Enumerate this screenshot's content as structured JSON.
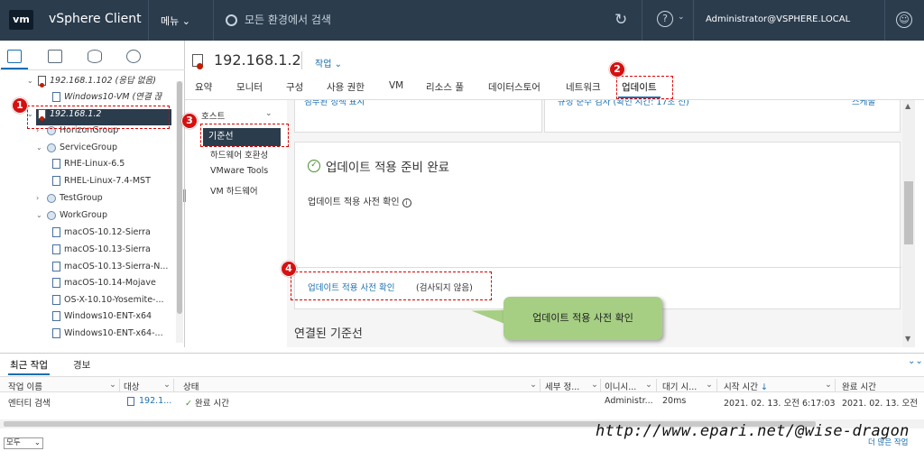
{
  "header": {
    "logo": "vm",
    "app_title": "vSphere Client",
    "menu_label": "메뉴",
    "search_placeholder": "모든 환경에서 검색",
    "user": "Administrator@VSPHERE.LOCAL",
    "colors": {
      "header_bg": "#2b3c4d",
      "accent": "#1a6fb0",
      "selected_bg": "#2b3c4d",
      "annotation": "#d51010",
      "tooltip_bg": "#a6cf84"
    }
  },
  "left_tabs": [
    "hosts-and-clusters-icon",
    "vms-and-templates-icon",
    "storage-icon",
    "networking-icon"
  ],
  "tree": [
    {
      "label": "192.168.1.102 (응답 없음)",
      "type": "host-warning",
      "expanded": true
    },
    {
      "label": "Windows10-VM (연결 끊",
      "type": "vm"
    },
    {
      "label": "192.168.1.2",
      "type": "host-warning",
      "expanded": true,
      "selected": true
    },
    {
      "label": "HorizonGroup",
      "type": "group",
      "expanded": false
    },
    {
      "label": "ServiceGroup",
      "type": "group",
      "expanded": true
    },
    {
      "label": "RHE-Linux-6.5",
      "type": "vm"
    },
    {
      "label": "RHEL-Linux-7.4-MST",
      "type": "vm"
    },
    {
      "label": "TestGroup",
      "type": "group",
      "expanded": false
    },
    {
      "label": "WorkGroup",
      "type": "group",
      "expanded": true
    },
    {
      "label": "macOS-10.12-Sierra",
      "type": "vm"
    },
    {
      "label": "macOS-10.13-Sierra",
      "type": "vm"
    },
    {
      "label": "macOS-10.13-Sierra-N...",
      "type": "vm"
    },
    {
      "label": "macOS-10.14-Mojave",
      "type": "vm"
    },
    {
      "label": "OS-X-10.10-Yosemite-...",
      "type": "vm"
    },
    {
      "label": "Windows10-ENT-x64",
      "type": "vm"
    },
    {
      "label": "Windows10-ENT-x64-...",
      "type": "vm"
    }
  ],
  "object": {
    "title": "192.168.1.2",
    "actions_label": "작업"
  },
  "tabs": [
    "요약",
    "모니터",
    "구성",
    "사용 권한",
    "VM",
    "리소스 풀",
    "데이터스토어",
    "네트워크",
    "업데이트"
  ],
  "active_tab": "업데이트",
  "subnav": {
    "section": "호스트",
    "items": [
      "기준선",
      "하드웨어 호환성",
      "VMware Tools",
      "VM 하드웨어"
    ],
    "selected": "기준선"
  },
  "content": {
    "cut_left": "첨부된 정책 표시",
    "cut_right": "규정 준수 검사 (확인 시간: 17초 전)",
    "cut_right_link": "스케줄",
    "ready_title": "업데이트 적용 준비 완료",
    "precheck_label": "업데이트 적용 사전 확인",
    "precheck_link": "업데이트 적용 사전 확인",
    "precheck_status": "(검사되지 않음)",
    "attached_baselines": "연결된 기준선"
  },
  "tooltip": "업데이트 적용 사전 확인",
  "annotations": [
    "1",
    "2",
    "3",
    "4"
  ],
  "bottom": {
    "tabs": [
      "최근 작업",
      "경보"
    ],
    "columns": [
      "작업 이름",
      "대상",
      "상태",
      "세부 정...",
      "이니시...",
      "대기 시...",
      "시작 시간",
      "완료 시간"
    ],
    "rows": [
      {
        "task": "엔터티 검색",
        "target": "192.1...",
        "status": "완료 시간",
        "details": "",
        "initiator": "Administr...",
        "queued": "20ms",
        "start": "2021. 02. 13. 오전 6:17:03",
        "end": "2021. 02. 13. 오전"
      }
    ],
    "filter": "모두",
    "more_tasks": "더 많은 작업"
  },
  "watermark": "http://www.epari.net/@wise-dragon"
}
